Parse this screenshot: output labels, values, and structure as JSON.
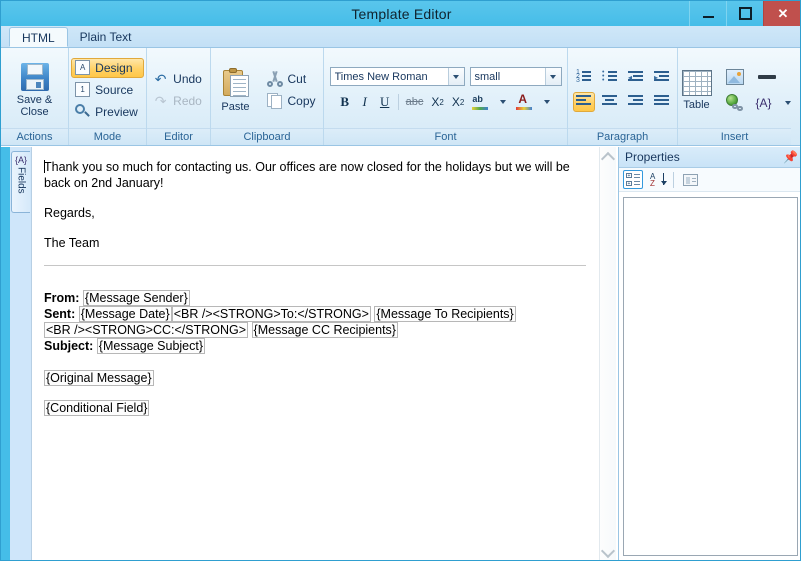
{
  "window": {
    "title": "Template Editor",
    "controls": {
      "minimize": "–",
      "maximize": "□",
      "close": "✕"
    }
  },
  "tabs": [
    {
      "label": "HTML",
      "active": true
    },
    {
      "label": "Plain Text",
      "active": false
    }
  ],
  "ribbon": {
    "groups": [
      {
        "label": "Actions",
        "items": [
          {
            "label": "Save &\nClose",
            "icon": "floppy-disk-icon"
          }
        ]
      },
      {
        "label": "Mode",
        "items": [
          {
            "label": "Design",
            "icon": "design-icon",
            "selected": true
          },
          {
            "label": "Source",
            "icon": "source-icon",
            "selected": false
          },
          {
            "label": "Preview",
            "icon": "magnifier-icon",
            "selected": false
          }
        ]
      },
      {
        "label": "Editor",
        "items": [
          {
            "label": "Undo",
            "icon": "undo-arrow-icon",
            "disabled": false
          },
          {
            "label": "Redo",
            "icon": "redo-arrow-icon",
            "disabled": true
          }
        ]
      },
      {
        "label": "Clipboard",
        "items": [
          {
            "label": "Paste",
            "icon": "clipboard-icon"
          },
          {
            "label": "Cut",
            "icon": "scissors-icon"
          },
          {
            "label": "Copy",
            "icon": "copy-pages-icon"
          }
        ]
      },
      {
        "label": "Font",
        "font_family": "Times New Roman",
        "font_size": "small",
        "buttons": [
          {
            "name": "bold",
            "label": "B"
          },
          {
            "name": "italic",
            "label": "I"
          },
          {
            "name": "underline",
            "label": "U"
          },
          {
            "name": "strikethrough",
            "label": "abc"
          },
          {
            "name": "subscript",
            "label": "X"
          },
          {
            "name": "superscript",
            "label": "X"
          },
          {
            "name": "highlight",
            "label": "ab"
          },
          {
            "name": "font-color",
            "label": "A"
          }
        ]
      },
      {
        "label": "Paragraph",
        "buttons": [
          {
            "name": "numbered-list"
          },
          {
            "name": "bulleted-list"
          },
          {
            "name": "decrease-indent"
          },
          {
            "name": "increase-indent"
          },
          {
            "name": "align-left",
            "selected": true
          },
          {
            "name": "align-center"
          },
          {
            "name": "align-right"
          },
          {
            "name": "justify"
          }
        ]
      },
      {
        "label": "Insert",
        "items": [
          {
            "label": "Table",
            "icon": "table-icon"
          },
          {
            "label": "",
            "icon": "image-icon"
          },
          {
            "label": "",
            "icon": "horizontal-rule-icon"
          },
          {
            "label": "",
            "icon": "hyperlink-globe-icon"
          },
          {
            "label": "",
            "icon": "field-braces-icon"
          }
        ]
      }
    ]
  },
  "left_rail": {
    "fields_tab": {
      "label": "Fields",
      "icon": "field-braces-icon"
    }
  },
  "editor": {
    "paragraph_1": "Thank you so much for contacting us. Our offices are now closed for the holidays but we will be back on 2nd January!",
    "paragraph_2": "Regards,",
    "paragraph_3": "The Team",
    "headers": {
      "from_label": "From:",
      "from_token": "{Message Sender}",
      "sent_label": "Sent:",
      "sent_token": "{Message Date}",
      "sent_markup_1": "<BR /><STRONG>To:</STRONG>",
      "to_token": "{Message To Recipients}",
      "sent_markup_2": "<BR /><STRONG>CC:</STRONG>",
      "cc_token": "{Message CC Recipients}",
      "subject_label": "Subject:",
      "subject_token": "{Message Subject}"
    },
    "original_message_token": "{Original Message}",
    "conditional_field_token": "{Conditional Field}"
  },
  "properties": {
    "title": "Properties",
    "pin_icon": "pin-icon",
    "toolbar": [
      {
        "name": "categorized-button",
        "icon": "categorize-icon",
        "selected": true
      },
      {
        "name": "alphabetical-button",
        "icon": "sort-az-icon",
        "selected": false
      },
      {
        "name": "property-pages-button",
        "icon": "property-page-icon",
        "selected": false
      }
    ]
  },
  "colors": {
    "titlebar": "#4fc1ea",
    "close_button": "#c0504d",
    "ribbon_bg": "#e3f1fa",
    "selection_gold": "#ffd165",
    "accent_blue": "#17365d"
  }
}
